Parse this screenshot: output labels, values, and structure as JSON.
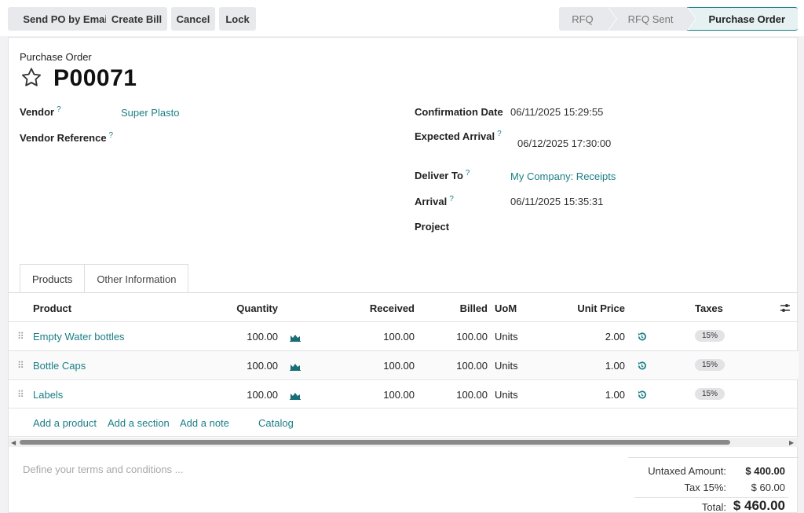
{
  "toolbar": {
    "send_po": "Send PO by Email",
    "create_bill": "Create Bill",
    "cancel": "Cancel",
    "lock": "Lock"
  },
  "stages": [
    "RFQ",
    "RFQ Sent",
    "Purchase Order"
  ],
  "header": {
    "subtitle": "Purchase Order",
    "reference": "P00071"
  },
  "fields": {
    "vendor_label": "Vendor",
    "vendor_value": "Super Plasto",
    "vendor_ref_label": "Vendor Reference",
    "confirmation_label": "Confirmation Date",
    "confirmation_value": "06/11/2025 15:29:55",
    "expected_label": "Expected Arrival",
    "expected_value": "06/12/2025 17:30:00",
    "deliver_label": "Deliver To",
    "deliver_value": "My Company: Receipts",
    "arrival_label": "Arrival",
    "arrival_value": "06/11/2025 15:35:31",
    "project_label": "Project",
    "help": "?"
  },
  "tabs": [
    "Products",
    "Other Information"
  ],
  "columns": {
    "product": "Product",
    "quantity": "Quantity",
    "received": "Received",
    "billed": "Billed",
    "uom": "UoM",
    "unit_price": "Unit Price",
    "taxes": "Taxes"
  },
  "lines": [
    {
      "product": "Empty Water bottles",
      "quantity": "100.00",
      "received": "100.00",
      "billed": "100.00",
      "uom": "Units",
      "unit_price": "2.00",
      "tax": "15%"
    },
    {
      "product": "Bottle Caps",
      "quantity": "100.00",
      "received": "100.00",
      "billed": "100.00",
      "uom": "Units",
      "unit_price": "1.00",
      "tax": "15%"
    },
    {
      "product": "Labels",
      "quantity": "100.00",
      "received": "100.00",
      "billed": "100.00",
      "uom": "Units",
      "unit_price": "1.00",
      "tax": "15%"
    }
  ],
  "add_links": {
    "product": "Add a product",
    "section": "Add a section",
    "note": "Add a note",
    "catalog": "Catalog"
  },
  "terms_placeholder": "Define your terms and conditions ...",
  "totals": {
    "untaxed_label": "Untaxed Amount:",
    "untaxed_value": "$ 400.00",
    "tax_label": "Tax 15%:",
    "tax_value": "$ 60.00",
    "total_label": "Total:",
    "total_value": "$ 460.00"
  },
  "colors": {
    "accent": "#1a7f86",
    "button_bg": "#e8e9ec"
  }
}
